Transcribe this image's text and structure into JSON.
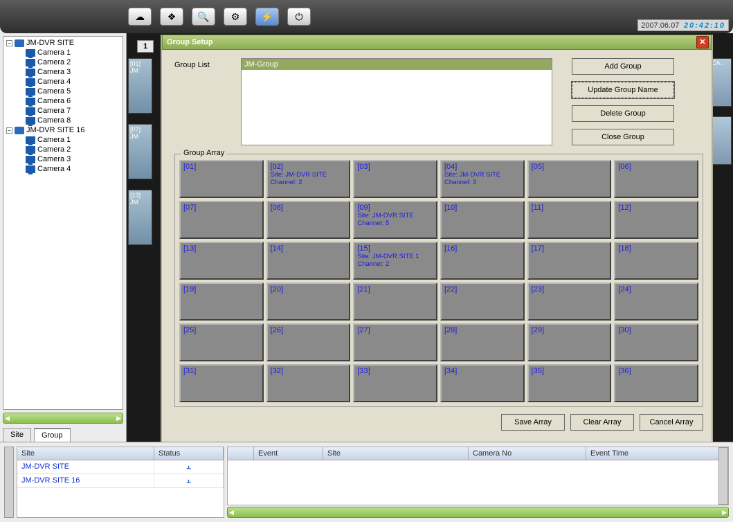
{
  "clock": {
    "date": "2007.06.07",
    "time": "20:42:10"
  },
  "toolbar": {
    "icons": [
      "☁",
      "❖",
      "🔍",
      "⚙",
      "⚡",
      "⏻"
    ]
  },
  "tree": {
    "sites": [
      {
        "name": "JM-DVR SITE",
        "cameras": [
          "Camera 1",
          "Camera 2",
          "Camera 3",
          "Camera 4",
          "Camera 5",
          "Camera 6",
          "Camera 7",
          "Camera 8"
        ]
      },
      {
        "name": "JM-DVR SITE 16",
        "cameras": [
          "Camera 1",
          "Camera 2",
          "Camera 3",
          "Camera 4"
        ]
      }
    ]
  },
  "tabs": {
    "site": "Site",
    "group": "Group"
  },
  "thumbs": [
    "[01] JM",
    "[07] JM",
    "[13] JM"
  ],
  "rightThumb": "CA..",
  "numTab": "1",
  "modal": {
    "title": "Group Setup",
    "groupListLabel": "Group List",
    "selectedGroup": "JM-Group",
    "buttons": {
      "add": "Add Group",
      "update": "Update Group Name",
      "del": "Delete Group",
      "close": "Close Group"
    },
    "arrayLabel": "Group Array",
    "cells": [
      {
        "i": "[01]"
      },
      {
        "i": "[02]",
        "s": "Site: JM-DVR SITE",
        "c": "Channel: 2"
      },
      {
        "i": "[03]"
      },
      {
        "i": "[04]",
        "s": "Site: JM-DVR SITE",
        "c": "Channel: 3"
      },
      {
        "i": "[05]"
      },
      {
        "i": "[06]"
      },
      {
        "i": "[07]"
      },
      {
        "i": "[08]"
      },
      {
        "i": "[09]",
        "s": "Site: JM-DVR SITE",
        "c": "Channel: 5"
      },
      {
        "i": "[10]"
      },
      {
        "i": "[11]"
      },
      {
        "i": "[12]"
      },
      {
        "i": "[13]"
      },
      {
        "i": "[14]"
      },
      {
        "i": "[15]",
        "s": "Site: JM-DVR SITE 1",
        "c": "Channel: 2"
      },
      {
        "i": "[16]"
      },
      {
        "i": "[17]"
      },
      {
        "i": "[18]"
      },
      {
        "i": "[19]"
      },
      {
        "i": "[20]"
      },
      {
        "i": "[21]"
      },
      {
        "i": "[22]"
      },
      {
        "i": "[23]"
      },
      {
        "i": "[24]"
      },
      {
        "i": "[25]"
      },
      {
        "i": "[26]"
      },
      {
        "i": "[27]"
      },
      {
        "i": "[28]"
      },
      {
        "i": "[29]"
      },
      {
        "i": "[30]"
      },
      {
        "i": "[31]"
      },
      {
        "i": "[32]"
      },
      {
        "i": "[33]"
      },
      {
        "i": "[34]"
      },
      {
        "i": "[35]"
      },
      {
        "i": "[36]"
      }
    ],
    "bottomButtons": {
      "save": "Save Array",
      "clear": "Clear Array",
      "cancel": "Cancel Array"
    }
  },
  "statusLeft": {
    "headers": {
      "site": "Site",
      "status": "Status"
    },
    "rows": [
      {
        "site": "JM-DVR SITE"
      },
      {
        "site": "JM-DVR SITE 16"
      }
    ]
  },
  "statusRight": {
    "headers": {
      "event": "Event",
      "site": "Site",
      "camno": "Camera No",
      "time": "Event Time"
    }
  }
}
